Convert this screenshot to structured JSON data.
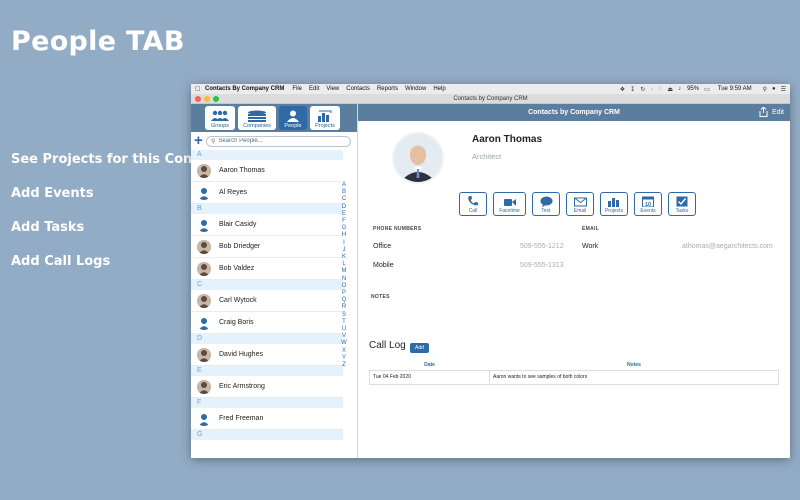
{
  "promo": {
    "title": "People TAB",
    "bullets": [
      "See Projects for this Contact",
      "Add Events",
      "Add Tasks",
      "Add Call Logs"
    ]
  },
  "menubar": {
    "app_name": "Contacts By Company CRM",
    "items": [
      "File",
      "Edit",
      "View",
      "Contacts",
      "Reports",
      "Window",
      "Help"
    ],
    "battery": "95%",
    "clock": "Tue 9:59 AM"
  },
  "window": {
    "title": "Contacts by Company CRM"
  },
  "sidebar": {
    "segments": [
      "Groups",
      "Companies",
      "People",
      "Projects"
    ],
    "active_segment": "People",
    "search_placeholder": "Search People...",
    "sections": [
      {
        "letter": "A",
        "contacts": [
          {
            "name": "Aaron Thomas",
            "photo": true
          },
          {
            "name": "Al Reyes",
            "photo": false
          }
        ]
      },
      {
        "letter": "B",
        "contacts": [
          {
            "name": "Blair Casidy",
            "photo": false
          },
          {
            "name": "Bob Driedger",
            "photo": true
          },
          {
            "name": "Bob Valdez",
            "photo": true
          }
        ]
      },
      {
        "letter": "C",
        "contacts": [
          {
            "name": "Carl Wytock",
            "photo": true
          },
          {
            "name": "Craig Boris",
            "photo": false
          }
        ]
      },
      {
        "letter": "D",
        "contacts": [
          {
            "name": "David Hughes",
            "photo": true
          }
        ]
      },
      {
        "letter": "E",
        "contacts": [
          {
            "name": "Eric Armstrong",
            "photo": true
          }
        ]
      },
      {
        "letter": "F",
        "contacts": [
          {
            "name": "Fred Freeman",
            "photo": false
          }
        ]
      },
      {
        "letter": "G",
        "contacts": []
      }
    ],
    "index_letters": [
      "A",
      "B",
      "C",
      "D",
      "E",
      "F",
      "G",
      "H",
      "I",
      "J",
      "K",
      "L",
      "M",
      "N",
      "O",
      "P",
      "Q",
      "R",
      "S",
      "T",
      "U",
      "V",
      "W",
      "X",
      "Y",
      "Z"
    ]
  },
  "detail": {
    "header_title": "Contacts by Company CRM",
    "edit_label": "Edit",
    "name": "Aaron Thomas",
    "role": "Architect",
    "actions": [
      "Call",
      "Facetime",
      "Text",
      "Email",
      "Projects",
      "Events",
      "Tasks"
    ],
    "events_badge": "10",
    "phone_section_label": "PHONE NUMBERS",
    "phones": [
      {
        "label": "Office",
        "value": "509-555-1212"
      },
      {
        "label": "Mobile",
        "value": "509-555-1313"
      }
    ],
    "email_section_label": "EMAIL",
    "email": {
      "label": "Work",
      "value": "athomas@aegarchitects.com"
    },
    "notes_label": "NOTES",
    "call_log_title": "Call Log",
    "add_label": "Add",
    "log_columns": [
      "Date",
      "Notes"
    ],
    "log_rows": [
      {
        "date": "Tue 04 Feb 2020",
        "notes": "Aaron wants to see samples of both colors"
      }
    ]
  },
  "colors": {
    "accent": "#2e6aa6",
    "header": "#5c7e9e",
    "background": "#93acc6",
    "section": "#e5f2fb"
  }
}
